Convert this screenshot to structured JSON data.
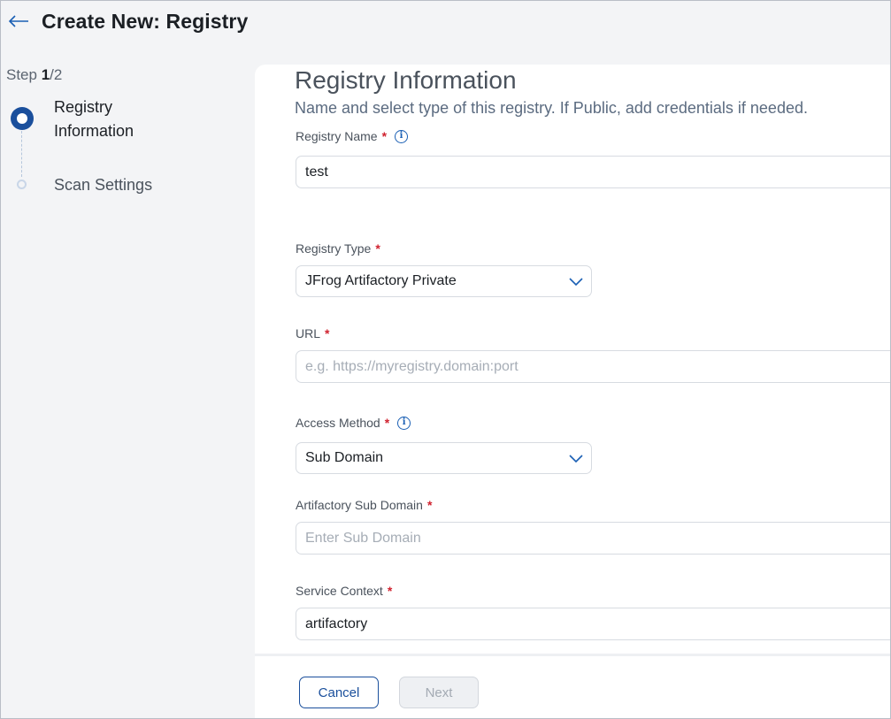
{
  "header": {
    "back_icon": "arrow-left-icon",
    "title": "Create New: Registry"
  },
  "stepper": {
    "step_word": "Step ",
    "current": "1",
    "total": "/2",
    "steps": [
      {
        "label": "Registry Information",
        "state": "active"
      },
      {
        "label": "Scan Settings",
        "state": "pending"
      }
    ]
  },
  "form": {
    "title": "Registry Information",
    "subtitle": "Name and select type of this registry. If Public, add credentials if needed.",
    "registry_name": {
      "label": "Registry Name",
      "required": "*",
      "value": "test",
      "info_icon": "info-icon"
    },
    "registry_type": {
      "label": "Registry Type",
      "required": "*",
      "value": "JFrog Artifactory Private"
    },
    "url": {
      "label": "URL",
      "required": "*",
      "value": "",
      "placeholder": "e.g. https://myregistry.domain:port"
    },
    "access_method": {
      "label": "Access Method",
      "required": "*",
      "value": "Sub Domain",
      "info_icon": "info-icon"
    },
    "sub_domain": {
      "label": "Artifactory Sub Domain",
      "required": "*",
      "value": "",
      "placeholder": "Enter Sub Domain"
    },
    "service_context": {
      "label": "Service Context",
      "required": "*",
      "value": "artifactory"
    }
  },
  "footer": {
    "cancel_label": "Cancel",
    "next_label": "Next"
  },
  "colors": {
    "accent": "#1a4f9c",
    "link": "#1a5fb4",
    "required": "#d0222f"
  }
}
